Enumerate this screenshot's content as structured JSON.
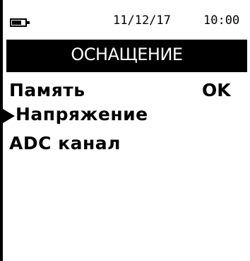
{
  "status_bar": {
    "battery_icon": "battery-icon",
    "date": "11/12/17",
    "time": "10:00"
  },
  "title": "ОСНАЩЕНИЕ",
  "menu": {
    "items": [
      {
        "label": "Память",
        "value": "OK"
      },
      {
        "label": "Напряжение",
        "value": ""
      },
      {
        "label": "ADC канал",
        "value": ""
      }
    ],
    "selected_index": 1,
    "cursor_icon": "selection-arrow-icon"
  },
  "colors": {
    "background": "#ffffff",
    "foreground": "#000000",
    "title_text": "#ffffff"
  }
}
